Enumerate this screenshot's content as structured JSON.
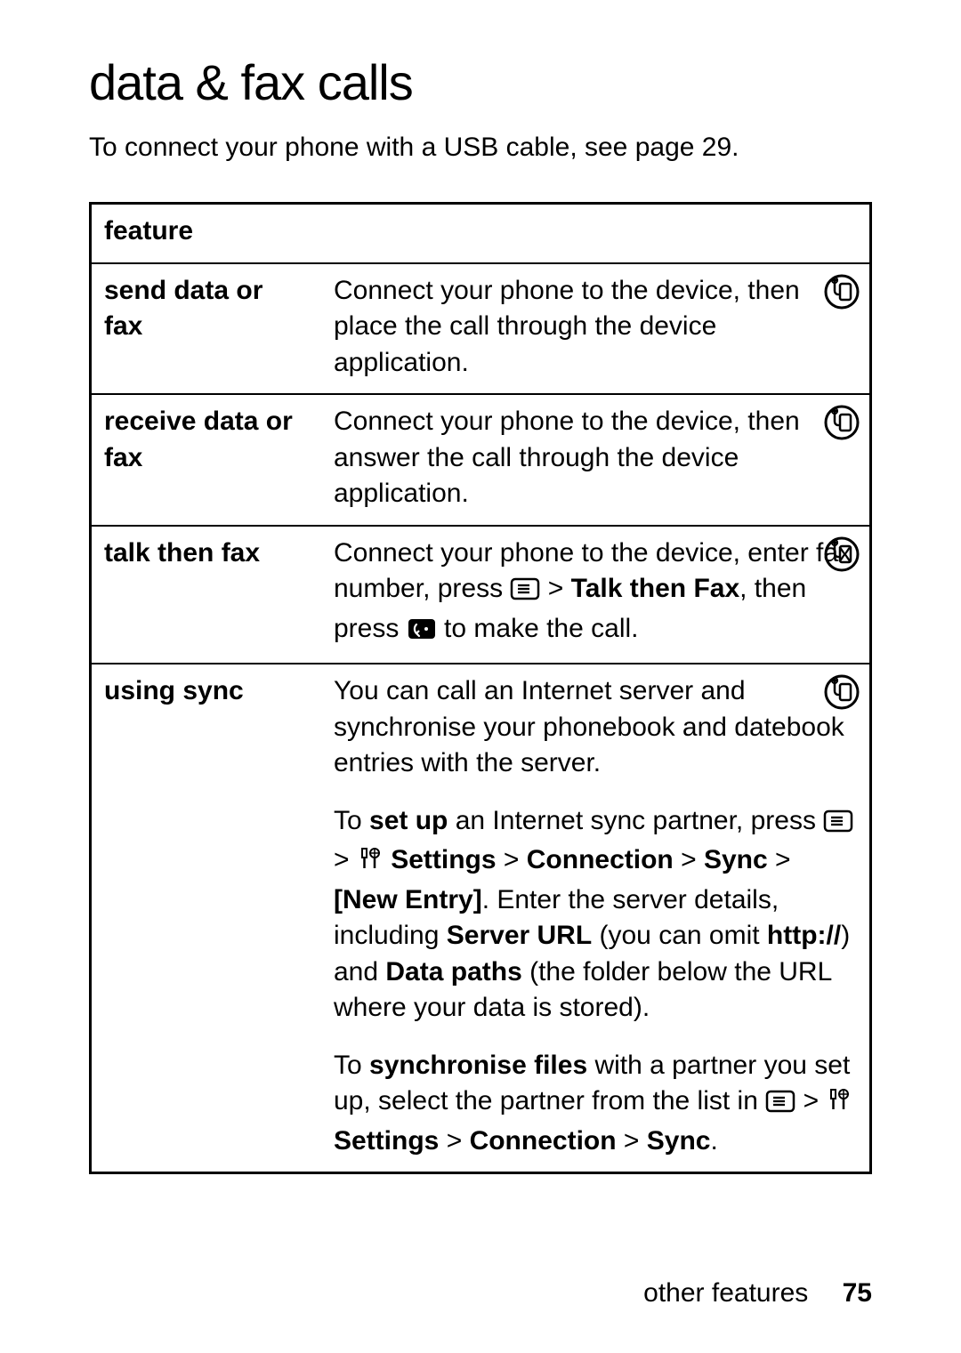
{
  "title": "data & fax calls",
  "intro": "To connect your phone with a USB cable, see page 29.",
  "table": {
    "header": "feature",
    "rows": {
      "send": {
        "name": "send data or fax",
        "desc": "Connect your phone to the device, then place the call through the device application."
      },
      "receive": {
        "name": "receive data or fax",
        "desc": "Connect your phone to the device, then answer the call through the device application."
      },
      "talk": {
        "name": "talk then fax",
        "d1": "Connect your phone to the device, enter fax number, press ",
        "d2": " > ",
        "d2b": "Talk then Fax",
        "d3": ", then press ",
        "d4": " to make the call."
      },
      "sync": {
        "name": "using sync",
        "p1": "You can call an Internet server and synchronise your phonebook and datebook entries with the server.",
        "p2a": "To ",
        "p2b": "set up",
        "p2c": " an Internet sync partner, press ",
        "p2d": " > ",
        "p2e": "Settings",
        "p2f": " > ",
        "p2g": "Connection",
        "p2h": " > ",
        "p2i": "Sync",
        "p2j": " > ",
        "p2k": "[New Entry]",
        "p2l": ". Enter the server details, including ",
        "p2m": "Server URL",
        "p2n": " (you can omit ",
        "p2o": "http://",
        "p2p": ") and ",
        "p2q": "Data paths",
        "p2r": " (the folder below the URL where your data is stored).",
        "p3a": "To ",
        "p3b": "synchronise files",
        "p3c": " with a partner you set up, select the partner from the list in ",
        "p3d": " > ",
        "p3e": "Settings",
        "p3f": " > ",
        "p3g": "Connection",
        "p3h": " > ",
        "p3i": "Sync",
        "p3j": "."
      }
    }
  },
  "footer": {
    "label": "other features",
    "page": "75"
  }
}
